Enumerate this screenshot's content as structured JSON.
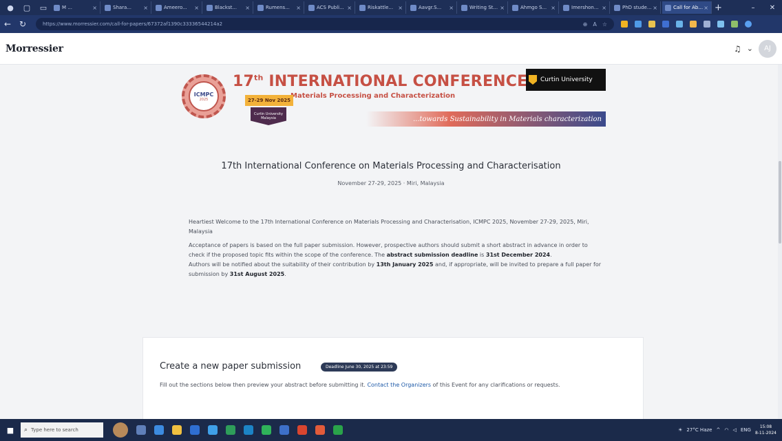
{
  "browser": {
    "tabs": [
      {
        "label": "M ...",
        "active": false
      },
      {
        "label": "Shara...",
        "active": false
      },
      {
        "label": "Ameero...",
        "active": false
      },
      {
        "label": "Blackst...",
        "active": false
      },
      {
        "label": "Rumens...",
        "active": false
      },
      {
        "label": "ACS Publi...",
        "active": false
      },
      {
        "label": "Riskattle...",
        "active": false
      },
      {
        "label": "Aavgr.S...",
        "active": false
      },
      {
        "label": "Writing St...",
        "active": false
      },
      {
        "label": "Ahmgo S...",
        "active": false
      },
      {
        "label": "Imershon...",
        "active": false
      },
      {
        "label": "PhD stude...",
        "active": false
      },
      {
        "label": "Call for Ab...",
        "active": true
      }
    ],
    "new_tab": "+",
    "url": "https://www.morressier.com/call-for-papers/67372af1390c33336544214a2"
  },
  "header": {
    "logo": "Morressier",
    "avatar_initials": "AJ"
  },
  "banner": {
    "gear_text": "ICMPC",
    "gear_year": "2025",
    "title_num": "17",
    "title_sup": "th",
    "title_rest": " INTERNATIONAL CONFERENCE ON",
    "subtitle": "Materials Processing and Characterization",
    "date": "27-29 Nov 2025",
    "venue": "Curtin University Malaysia",
    "university": "Curtin University",
    "tagline": "...towards Sustainability in Materials characterization"
  },
  "conference": {
    "title": "17th International Conference on Materials Processing and Characterisation",
    "date_location": "November 27-29, 2025 · Miri, Malaysia"
  },
  "intro": {
    "p1": "Heartiest Welcome to the 17th International Conference on Materials Processing and Characterisation, ICMPC 2025, November 27-29, 2025, Miri, Malaysia",
    "p2_a": "Acceptance of papers is based on the full paper submission. However, prospective authors should submit a short abstract in advance in order to check if the proposed topic fits within the scope of the conference. The ",
    "p2_b": "abstract submission deadline",
    "p2_c": " is ",
    "p2_d": "31st December 2024",
    "p2_e": ".",
    "p3_a": "Authors will be notified about the suitability of their contribution by ",
    "p3_b": "13th January 2025",
    "p3_c": " and, if appropriate, will be invited to prepare a full paper for submission by ",
    "p3_d": "31st August 2025",
    "p3_e": "."
  },
  "submission": {
    "title": "Create a new paper submission",
    "deadline_badge": "Deadline June 30, 2025 at 23:59",
    "text_a": "Fill out the sections below then preview your abstract before submitting it. ",
    "link": "Contact the Organizers",
    "text_b": " of this Event for any clarifications or requests."
  },
  "taskbar": {
    "search_placeholder": "Type here to search",
    "weather": "27°C Haze",
    "lang": "ENG",
    "time": "15:08",
    "date": "8-11-2024"
  },
  "colors": {
    "chrome_dark": "#1e2f57",
    "accent_red": "#c65044",
    "link": "#1e5aa8",
    "badge": "#2d3a57"
  }
}
